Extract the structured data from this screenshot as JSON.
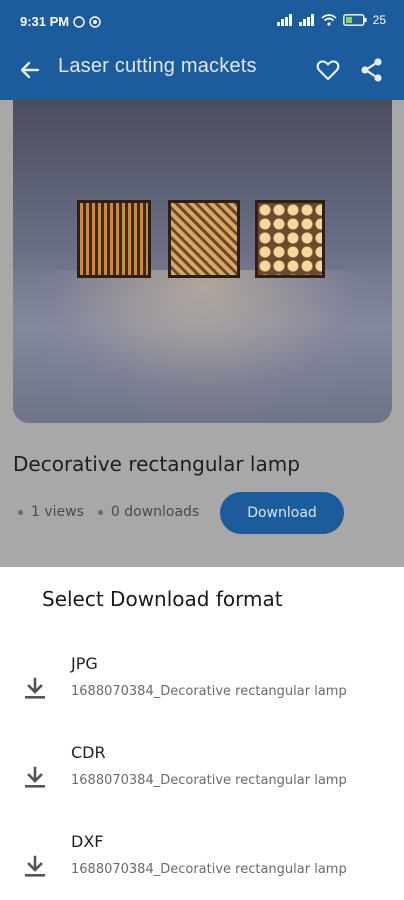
{
  "status_bar": {
    "time": "9:31 PM",
    "battery": "25"
  },
  "app_bar": {
    "title": "Laser cutting mackets",
    "icons": [
      "back-arrow-icon",
      "heart-icon",
      "share-icon"
    ]
  },
  "product": {
    "title": "Decorative rectangular lamp",
    "views": "1 views",
    "downloads": "0 downloads",
    "download_label": "Download"
  },
  "sheet": {
    "title": "Select Download format",
    "formats": [
      {
        "label": "JPG",
        "file": "1688070384_Decorative rectangular lamp"
      },
      {
        "label": "CDR",
        "file": "1688070384_Decorative rectangular lamp"
      },
      {
        "label": "DXF",
        "file": "1688070384_Decorative rectangular lamp"
      }
    ]
  },
  "colors": {
    "primary": "#1565c0",
    "scrim_overlay": "#a8a8a8",
    "sheet_background": "#ffffff"
  }
}
